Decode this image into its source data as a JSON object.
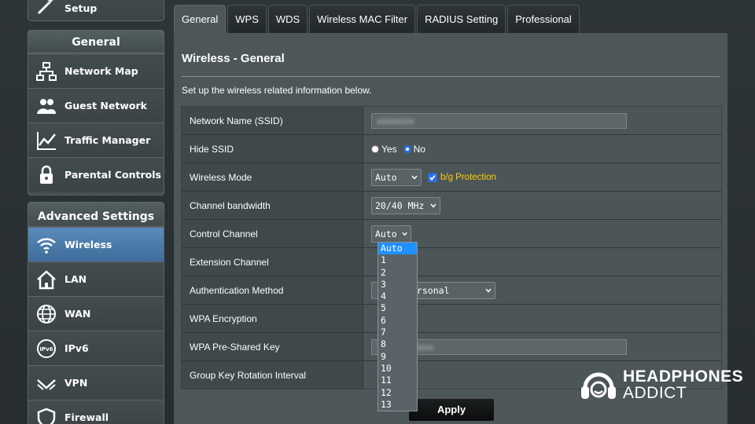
{
  "sidebar": {
    "setup_label": "Setup",
    "general": {
      "header": "General",
      "items": [
        "Network Map",
        "Guest Network",
        "Traffic Manager",
        "Parental Controls"
      ]
    },
    "advanced": {
      "header": "Advanced Settings",
      "items": [
        "Wireless",
        "LAN",
        "WAN",
        "IPv6",
        "VPN",
        "Firewall"
      ],
      "active": "Wireless"
    }
  },
  "tabs": [
    "General",
    "WPS",
    "WDS",
    "Wireless MAC Filter",
    "RADIUS Setting",
    "Professional"
  ],
  "active_tab": "General",
  "page": {
    "title": "Wireless - General",
    "description": "Set up the wireless related information below."
  },
  "form": {
    "ssid": {
      "label": "Network Name (SSID)",
      "value": "xxxxxxxx"
    },
    "hide_ssid": {
      "label": "Hide SSID",
      "yes": "Yes",
      "no": "No",
      "selected": "No"
    },
    "wireless_mode": {
      "label": "Wireless Mode",
      "value": "Auto",
      "protection_label": "b/g Protection",
      "protection_checked": true
    },
    "channel_bandwidth": {
      "label": "Channel bandwidth",
      "value": "20/40 MHz"
    },
    "control_channel": {
      "label": "Control Channel",
      "value": "Auto"
    },
    "extension_channel": {
      "label": "Extension Channel"
    },
    "auth_method": {
      "label": "Authentication Method",
      "value": "ersonal"
    },
    "wpa_encryption": {
      "label": "WPA Encryption"
    },
    "wpa_key": {
      "label": "WPA Pre-Shared Key",
      "value": "xxxx"
    },
    "group_key": {
      "label": "Group Key Rotation Interval"
    }
  },
  "control_channel_options": [
    "Auto",
    "1",
    "2",
    "3",
    "4",
    "5",
    "6",
    "7",
    "8",
    "9",
    "10",
    "11",
    "12",
    "13"
  ],
  "apply_label": "Apply",
  "watermark": {
    "line1": "HEADPHONES",
    "line2": "ADDICT"
  },
  "colors": {
    "active_blue": "#3e6c9a",
    "highlight": "#1e90ff",
    "protection_text": "#ffcc00"
  }
}
